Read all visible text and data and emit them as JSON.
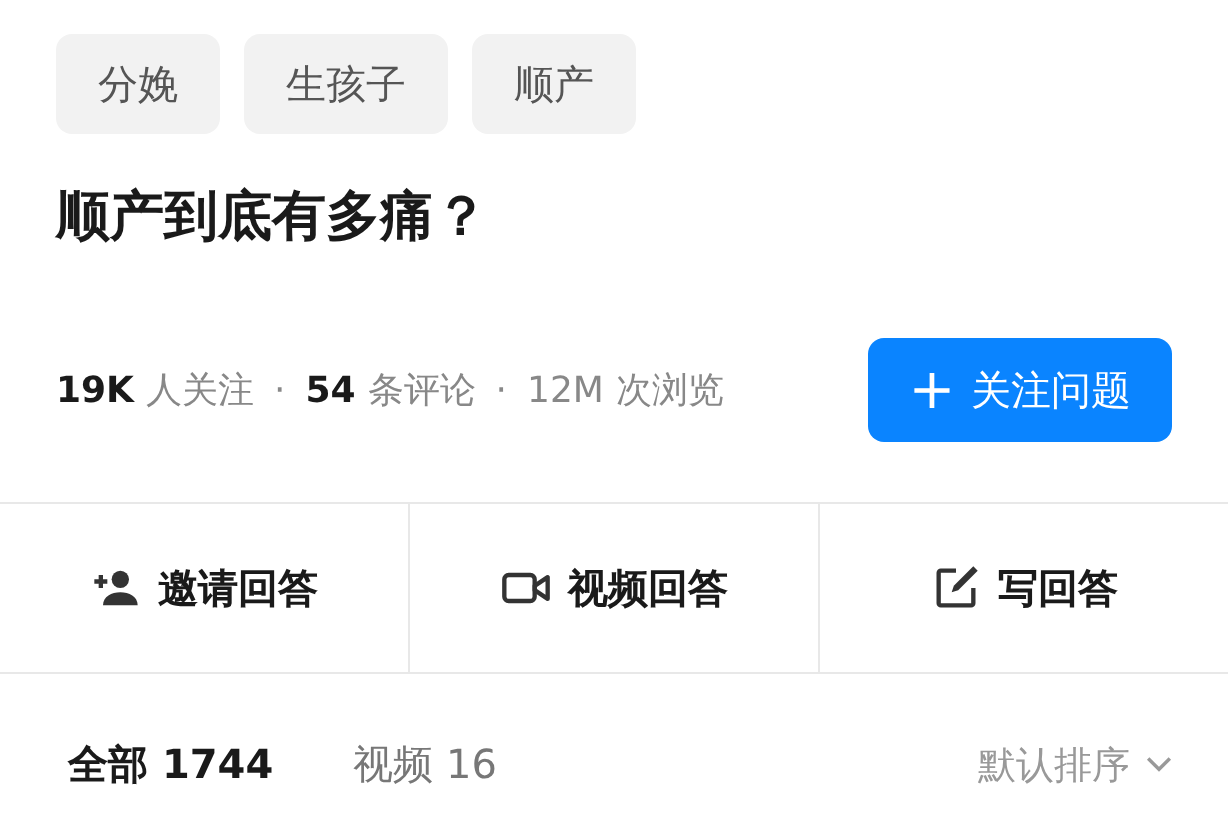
{
  "tags": [
    "分娩",
    "生孩子",
    "顺产"
  ],
  "title": "顺产到底有多痛？",
  "stats": [
    {
      "value": "19K",
      "unit": "人关注",
      "emphasis": true
    },
    {
      "value": "54",
      "unit": "条评论",
      "emphasis": true
    },
    {
      "value": "12M",
      "unit": "次浏览",
      "emphasis": false
    }
  ],
  "separator": "·",
  "follow_button": {
    "icon": "+",
    "label": "关注问题"
  },
  "actions": [
    {
      "kind": "invite",
      "label": "邀请回答"
    },
    {
      "kind": "video",
      "label": "视频回答"
    },
    {
      "kind": "write",
      "label": "写回答"
    }
  ],
  "tabs": [
    {
      "label": "全部 1744",
      "selected": true
    },
    {
      "label": "视频 16",
      "selected": false
    }
  ],
  "sort": {
    "label": "默认排序"
  }
}
